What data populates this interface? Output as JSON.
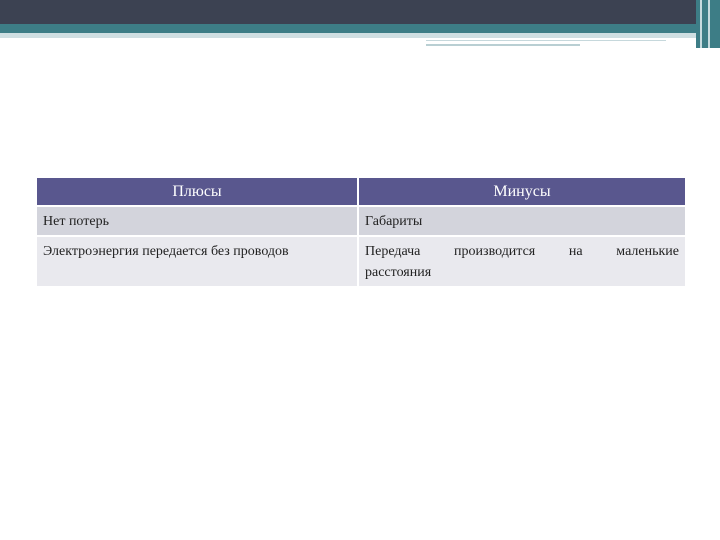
{
  "table": {
    "headers": [
      "Плюсы",
      "Минусы"
    ],
    "rows": [
      {
        "pros": "Нет потерь",
        "cons": "Габариты"
      },
      {
        "pros": "Электроэнергия передается без проводов",
        "cons_line1": "Передача производится на маленькие",
        "cons_line2": "расстояния"
      }
    ]
  },
  "colors": {
    "header_bg": "#59578e",
    "row_odd_bg": "#d3d4dc",
    "row_even_bg": "#e9e9ee",
    "topbar_dark": "#3c4252",
    "topbar_teal": "#3d7d86"
  }
}
